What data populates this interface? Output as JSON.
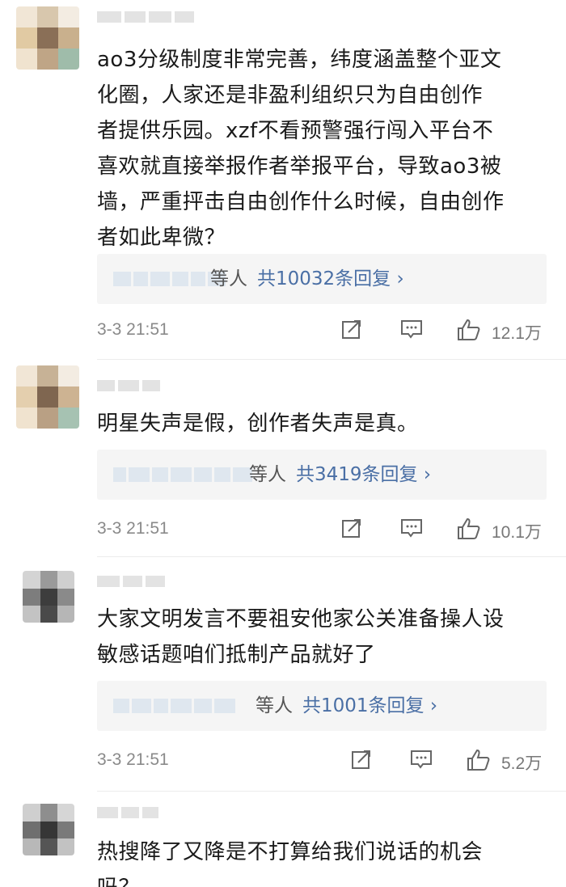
{
  "comments": [
    {
      "text": "ao3分级制度非常完善，纬度涵盖整个亚文\n化圈，人家还是非盈利组织只为自由创作\n者提供乐园。xzf不看预警强行闯入平台不\n喜欢就直接举报作者举报平台，导致ao3被\n墙，严重抨击自由创作什么时候，自由创作\n者如此卑微？",
      "reply_suffix": "等人",
      "reply_count": "共10032条回复 ›",
      "time": "3-3 21:51",
      "likes": "12.1万"
    },
    {
      "text": "明星失声是假，创作者失声是真。",
      "reply_suffix": "等人",
      "reply_count": "共3419条回复 ›",
      "time": "3-3 21:51",
      "likes": "10.1万"
    },
    {
      "text": "大家文明发言不要祖安他家公关准备操人设\n敏感话题咱们抵制产品就好了",
      "reply_suffix": "等人",
      "reply_count": "共1001条回复 ›",
      "time": "3-3 21:51",
      "likes": "5.2万"
    },
    {
      "text": "热搜降了又降是不打算给我们说话的机会\n吗？"
    }
  ],
  "icons": {
    "repost": "share-icon",
    "comment": "comment-icon",
    "like": "thumbs-up-icon"
  },
  "colors": {
    "text": "#1a1a1a",
    "link": "#4a6fa5",
    "meta": "#8a8a8a",
    "reply_bg": "#f5f5f5"
  }
}
